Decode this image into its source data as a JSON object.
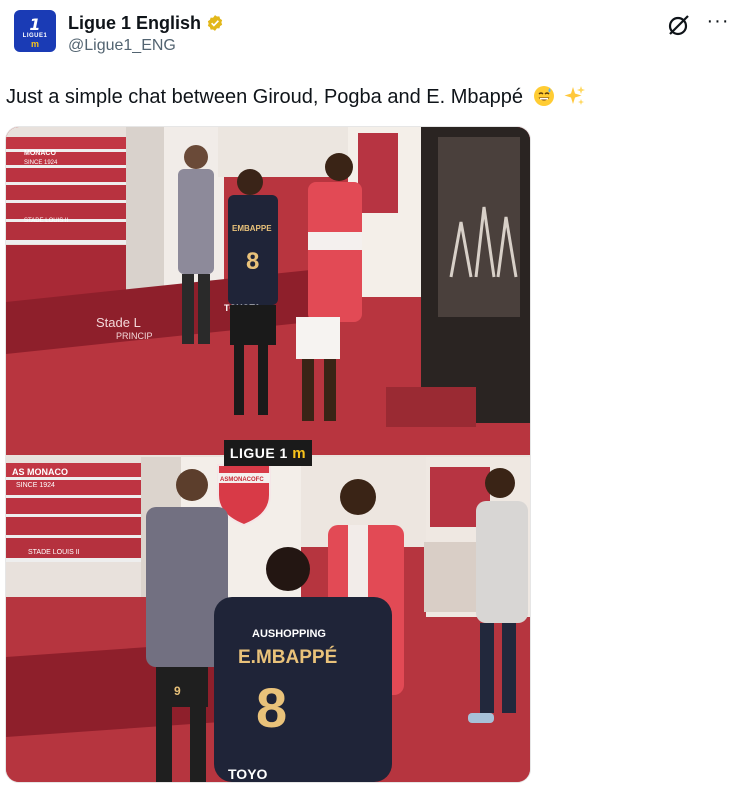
{
  "account": {
    "display_name": "Ligue 1 English",
    "handle": "@Ligue1_ENG",
    "avatar_text": "LIGUE1",
    "avatar_logo": "1"
  },
  "tweet": {
    "text": "Just a simple chat between Giroud, Pogba and E. Mbappé",
    "emojis": [
      "grinning-sweat-emoji",
      "sparkles-emoji"
    ]
  },
  "media": {
    "watermark_text": "LIGUE 1",
    "top_photo": {
      "wall_sign_lines": [
        "MONACO",
        "SINCE 1924"
      ],
      "step_label": "STADE LOUIS II",
      "floor_text": [
        "Stade L",
        "PRINCIP"
      ],
      "jersey_name": "EMBAPPE",
      "jersey_number": "8",
      "jersey_sponsor": "TOYOTA"
    },
    "bottom_photo": {
      "wall_sign_lines": [
        "AS MONACO",
        "SINCE 1924"
      ],
      "step_label": "STADE LOUIS II",
      "crest_text": "ASMONACOFC",
      "jersey_sponsor": "AUSHOPPING",
      "jersey_name": "E.MBAPPÉ",
      "jersey_number": "8",
      "shorts_number": "9",
      "bottom_sponsor": "TOYO"
    }
  },
  "colors": {
    "brand_blue": "#1a3bb5",
    "verified_gold": "#e2b719",
    "tunnel_red": "#c9424d"
  },
  "icons": {
    "verified": "verified-badge-icon",
    "grok": "grok-icon",
    "more": "more-options-icon"
  }
}
